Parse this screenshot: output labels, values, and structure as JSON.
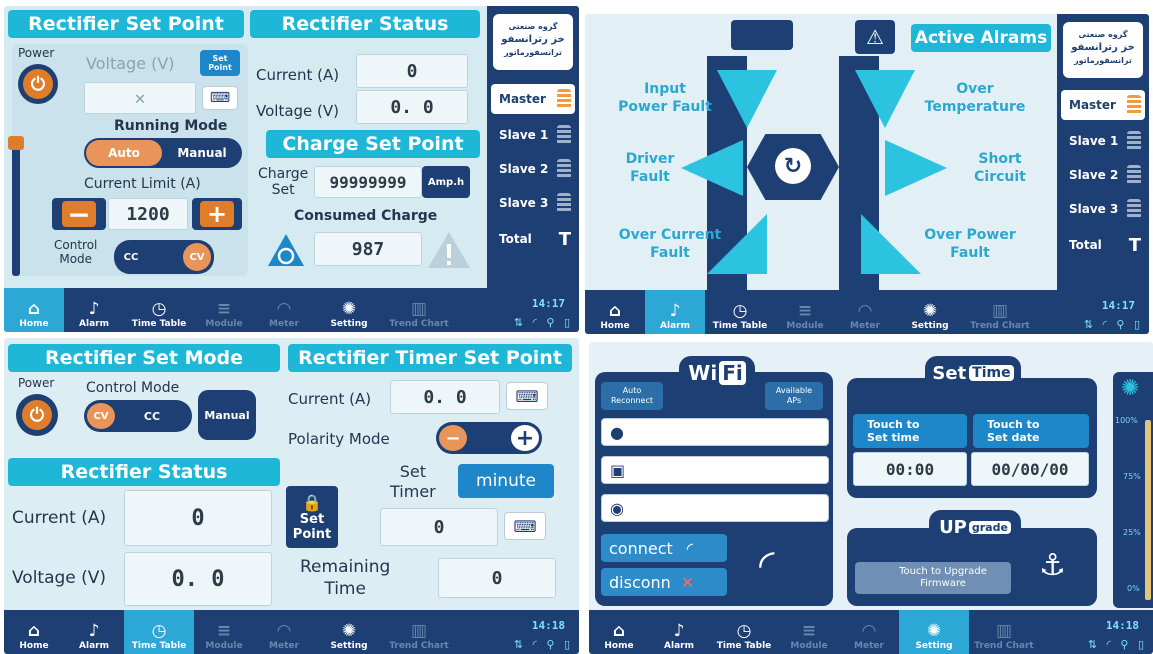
{
  "nav": {
    "home": "Home",
    "alarm": "Alarm",
    "timetable": "Time Table",
    "module": "Module",
    "meter": "Meter",
    "setting": "Setting",
    "trend": "Trend Chart"
  },
  "side": {
    "logo_line1": "گروه صنعتی",
    "logo_main": "خز رترانسفو",
    "logo_line3": "ترانسفورماتور",
    "master": "Master",
    "slave1": "Slave 1",
    "slave2": "Slave 2",
    "slave3": "Slave 3",
    "total": "Total",
    "total_icon": "T"
  },
  "p1": {
    "title_setpoint": "Rectifier Set Point",
    "title_status": "Rectifier Status",
    "power": "Power",
    "voltage_label": "Voltage (V)",
    "setpoint_badge_1": "Set",
    "setpoint_badge_2": "Point",
    "running_mode": "Running Mode",
    "auto": "Auto",
    "manual": "Manual",
    "current_limit": "Current Limit (A)",
    "current_limit_value": "1200",
    "control_mode_1": "Control",
    "control_mode_2": "Mode",
    "cc": "CC",
    "cv": "CV",
    "current_label": "Current (A)",
    "current_value": "0",
    "voltage_label2": "Voltage (V)",
    "voltage_value": "0. 0",
    "charge_title": "Charge Set Point",
    "charge_set_1": "Charge",
    "charge_set_2": "Set",
    "charge_value": "99999999",
    "amph": "Amp.h",
    "consumed": "Consumed Charge",
    "consumed_value": "987",
    "clock": "14:17"
  },
  "p2": {
    "title": "Active Alrams",
    "input_1": "Input",
    "input_2": "Power Fault",
    "over_1": "Over",
    "over_2": "Temperature",
    "driver_1": "Driver",
    "driver_2": "Fault",
    "short_1": "Short",
    "short_2": "Circuit",
    "oc_1": "Over Current",
    "oc_2": "Fault",
    "op_1": "Over Power",
    "op_2": "Fault",
    "clock": "14:17"
  },
  "p3": {
    "title_mode": "Rectifier Set Mode",
    "title_timer": "Rectifier Timer Set Point",
    "power": "Power",
    "control_mode": "Control Mode",
    "cv": "CV",
    "cc": "CC",
    "manual": "Manual",
    "current_label": "Current (A)",
    "current_value": "0. 0",
    "polarity": "Polarity Mode",
    "minus": "−",
    "plus": "+",
    "status_title": "Rectifier Status",
    "status_current": "Current (A)",
    "status_current_value": "0",
    "status_voltage": "Voltage (V)",
    "status_voltage_value": "0. 0",
    "set_timer_1": "Set",
    "set_timer_2": "Timer",
    "minute": "minute",
    "setpoint_1": "Set",
    "setpoint_2": "Point",
    "timer_value": "0",
    "remaining_1": "Remaining",
    "remaining_2": "Time",
    "remaining_value": "0",
    "clock": "14:18"
  },
  "p4": {
    "wifi_1": "Wi",
    "wifi_2": "Fi",
    "auto_1": "Auto",
    "auto_2": "Reconnect",
    "available_1": "Available",
    "available_2": "APs",
    "connect": "connect",
    "disconn": "disconn",
    "set_1": "Set",
    "set_2": "Time",
    "touch_time_1": "Touch to",
    "touch_time_2": "Set time",
    "touch_date_1": "Touch to",
    "touch_date_2": "Set date",
    "time_value": "00:00",
    "date_value": "00/00/00",
    "up_1": "UP",
    "up_2": "grade",
    "upgrade_btn_1": "Touch to Upgrade",
    "upgrade_btn_2": "Firmware",
    "pct100": "100%",
    "pct75": "75%",
    "pct25": "25%",
    "pct0": "0%",
    "clock": "14:18"
  }
}
